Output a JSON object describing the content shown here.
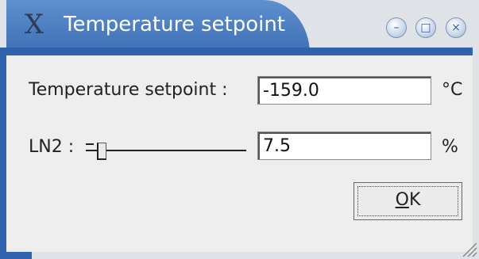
{
  "window": {
    "title": "Temperature setpoint",
    "icon": "x-icon",
    "icon_glyph": "X"
  },
  "titlebar_buttons": {
    "minimize_icon": "minimize-icon",
    "maximize_icon": "maximize-icon",
    "close_icon": "close-icon",
    "minimize_glyph": "–",
    "maximize_glyph": "□",
    "close_glyph": "×"
  },
  "form": {
    "setpoint_label": "Temperature setpoint :",
    "setpoint_value": "-159.0",
    "setpoint_unit": "°C",
    "ln2_label": "LN2 :",
    "ln2_value": "7.5",
    "ln2_unit": "%",
    "ln2_slider_level_percent": 7.5
  },
  "buttons": {
    "ok_mnemonic": "O",
    "ok_rest": "K"
  },
  "colors": {
    "title_accent": "#3e6fb5",
    "background": "#eeeeee"
  }
}
